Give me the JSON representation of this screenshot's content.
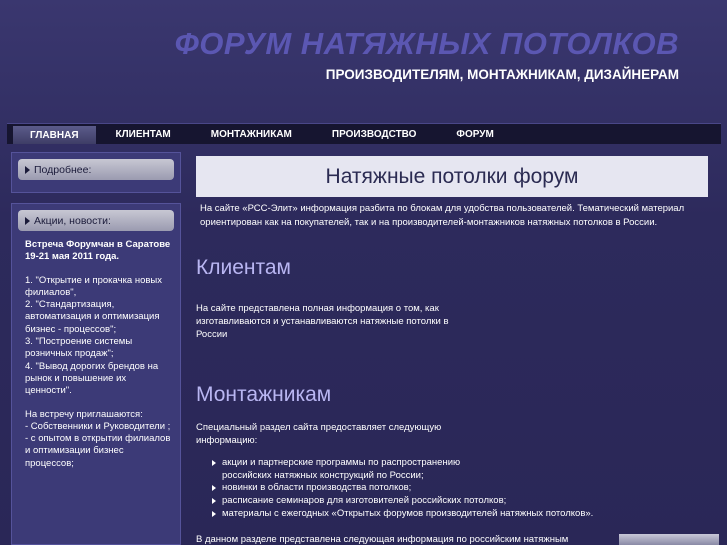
{
  "header": {
    "title": "ФОРУМ НАТЯЖНЫХ ПОТОЛКОВ",
    "subtitle": "ПРОИЗВОДИТЕЛЯМ, МОНТАЖНИКАМ, ДИЗАЙНЕРАМ"
  },
  "nav": {
    "items": [
      {
        "label": "ГЛАВНАЯ"
      },
      {
        "label": "КЛИЕНТАМ"
      },
      {
        "label": "МОНТАЖНИКАМ"
      },
      {
        "label": "ПРОИЗВОДСТВО"
      },
      {
        "label": "ФОРУМ"
      }
    ]
  },
  "sidebar": {
    "more_label": "Подробнее:",
    "news_label": "Акции, новости:",
    "news_heading": "Встреча Форумчан в Саратове 19-21 мая 2011 года.",
    "news_topics": "1. \"Открытие и прокачка новых филиалов\",\n2. \"Стандартизация, автоматизация и оптимизация бизнес - процессов\";\n3. \"Построение системы розничных продаж\";\n4. \"Вывод дорогих брендов на рынок и повышение их ценности\".",
    "invite_text": "На встречу приглашаются:\n- Собственники и Руководители ;\n- с опытом в открытии филиалов и оптимизации бизнес процессов;"
  },
  "main": {
    "page_title": "Натяжные потолки форум",
    "intro": "На сайте «РСС-Элит» информация разбита по блокам для удобства пользователей. Тематический материал ориентирован как на покупателей, так и на производителей-монтажников натяжных потолков в России.",
    "clients_title": "Клиентам",
    "clients_text": "На сайте представлена полная информация о том, как изготавливаются и устанавливаются натяжные потолки в России",
    "installers_title": "Монтажникам",
    "installers_text": "Специальный раздел сайта предоставляет следующую информацию:",
    "installers_list": [
      "акции и партнерские программы по распространению российских натяжных конструкций по России;",
      "новинки в области производства потолков;",
      "расписание семинаров для изготовителей российских потолков;",
      "материалы с ежегодных «Открытых форумов производителей натяжных потолков»."
    ],
    "bottom_text": "В данном разделе представлена следующая информация по российским натяжным"
  }
}
